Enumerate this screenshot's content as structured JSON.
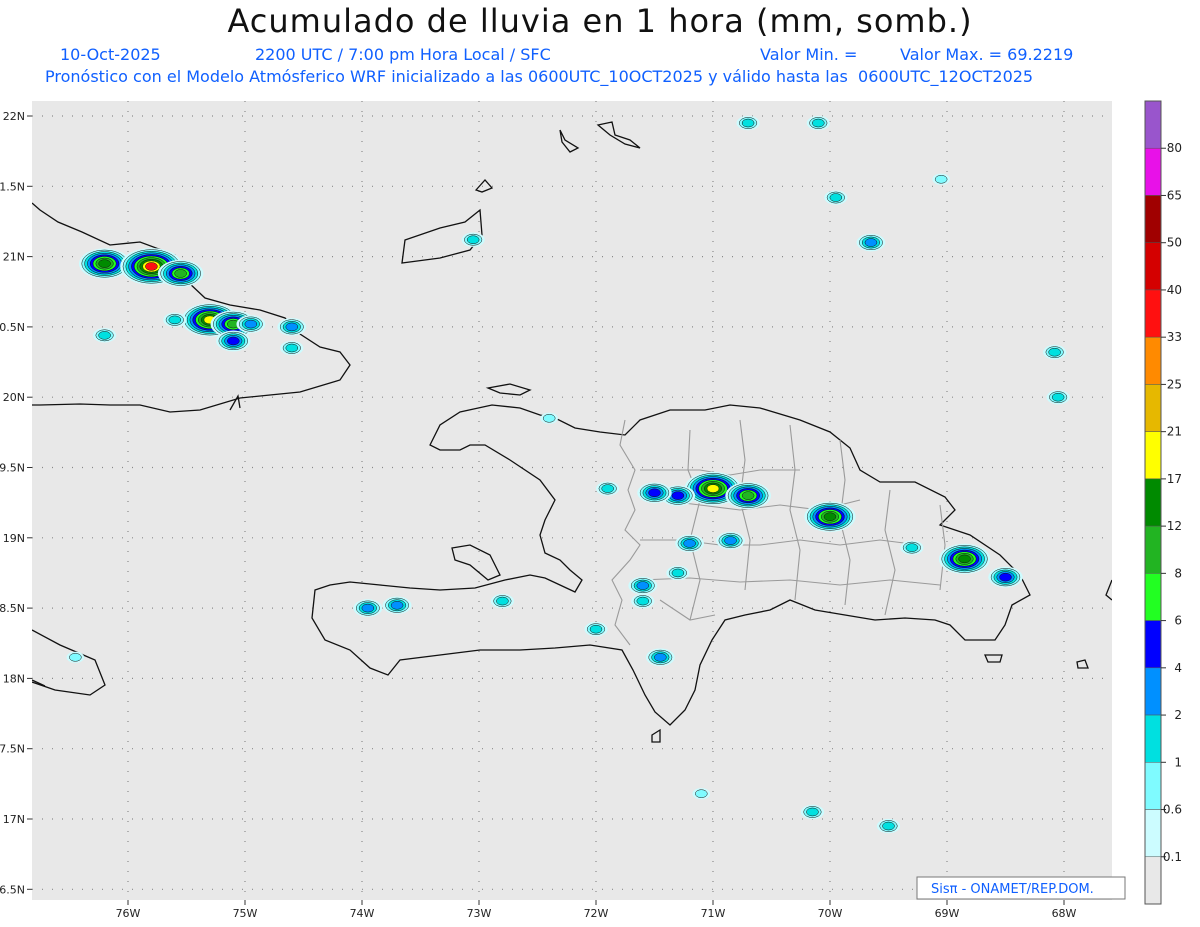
{
  "header": {
    "title": "Acumulado de lluvia en 1 hora (mm, somb.)",
    "date": "10-Oct-2025",
    "time": "2200 UTC / 7:00 pm Hora Local / SFC",
    "val_min": "Valor Min. =",
    "val_max": "Valor Max. = 69.2219",
    "forecast": "Pronóstico con el Modelo Atmósferico WRF inicializado a las 0600UTC_10OCT2025 y válido hasta las  0600UTC_12OCT2025"
  },
  "credit": "Sisπ - ONAMET/REP.DOM.",
  "axes": {
    "lon_labels": [
      "76W",
      "75W",
      "74W",
      "73W",
      "72W",
      "71W",
      "70W",
      "69W",
      "68W"
    ],
    "lat_labels": [
      "22N",
      "1.5N",
      "21N",
      "0.5N",
      "20N",
      "9.5N",
      "19N",
      "8.5N",
      "18N",
      "7.5N",
      "17N",
      "6.5N"
    ]
  },
  "colorbar": {
    "labels": [
      "80",
      "65",
      "50",
      "40",
      "33",
      "25",
      "21",
      "17",
      "12",
      "8",
      "6",
      "4",
      "2",
      "1",
      "0.6",
      "0.1"
    ],
    "colors": [
      "#9955cc",
      "#e811e8",
      "#a00000",
      "#d40000",
      "#ff1010",
      "#ff8a00",
      "#e6b800",
      "#ffff00",
      "#008a00",
      "#22b422",
      "#22ff22",
      "#0000ff",
      "#0090ff",
      "#00e0e0",
      "#7ffbff",
      "#ccfcff",
      "#e8e8e8"
    ]
  },
  "rain_cells": [
    {
      "lon": -76.2,
      "lat": 20.95,
      "level": 7
    },
    {
      "lon": -75.8,
      "lat": 20.93,
      "level": 9
    },
    {
      "lon": -75.55,
      "lat": 20.88,
      "level": 6
    },
    {
      "lon": -75.3,
      "lat": 20.55,
      "level": 8
    },
    {
      "lon": -75.1,
      "lat": 20.52,
      "level": 6
    },
    {
      "lon": -75.1,
      "lat": 20.4,
      "level": 4
    },
    {
      "lon": -74.95,
      "lat": 20.52,
      "level": 3
    },
    {
      "lon": -74.6,
      "lat": 20.5,
      "level": 3
    },
    {
      "lon": -74.6,
      "lat": 20.35,
      "level": 2
    },
    {
      "lon": -75.6,
      "lat": 20.55,
      "level": 2
    },
    {
      "lon": -76.2,
      "lat": 20.44,
      "level": 2
    },
    {
      "lon": -71.0,
      "lat": 19.35,
      "level": 8
    },
    {
      "lon": -70.7,
      "lat": 19.3,
      "level": 6
    },
    {
      "lon": -71.3,
      "lat": 19.3,
      "level": 4
    },
    {
      "lon": -71.5,
      "lat": 19.32,
      "level": 4
    },
    {
      "lon": -70.0,
      "lat": 19.15,
      "level": 7
    },
    {
      "lon": -68.85,
      "lat": 18.85,
      "level": 7
    },
    {
      "lon": -68.5,
      "lat": 18.72,
      "level": 4
    },
    {
      "lon": -70.85,
      "lat": 18.98,
      "level": 3
    },
    {
      "lon": -71.2,
      "lat": 18.96,
      "level": 3
    },
    {
      "lon": -71.6,
      "lat": 18.66,
      "level": 3
    },
    {
      "lon": -71.3,
      "lat": 18.75,
      "level": 2
    },
    {
      "lon": -71.45,
      "lat": 18.15,
      "level": 3
    },
    {
      "lon": -73.95,
      "lat": 18.5,
      "level": 3
    },
    {
      "lon": -73.7,
      "lat": 18.52,
      "level": 3
    },
    {
      "lon": -72.8,
      "lat": 18.55,
      "level": 2
    },
    {
      "lon": -69.3,
      "lat": 18.93,
      "level": 2
    },
    {
      "lon": -71.9,
      "lat": 19.35,
      "level": 2
    },
    {
      "lon": -71.6,
      "lat": 18.55,
      "level": 2
    },
    {
      "lon": -70.7,
      "lat": 21.95,
      "level": 2
    },
    {
      "lon": -70.1,
      "lat": 21.95,
      "level": 2
    },
    {
      "lon": -69.65,
      "lat": 21.1,
      "level": 3
    },
    {
      "lon": -69.95,
      "lat": 21.42,
      "level": 2
    },
    {
      "lon": -68.08,
      "lat": 20.32,
      "level": 2
    },
    {
      "lon": -68.05,
      "lat": 20.0,
      "level": 2
    },
    {
      "lon": -70.15,
      "lat": 17.05,
      "level": 2
    },
    {
      "lon": -69.5,
      "lat": 16.95,
      "level": 2
    },
    {
      "lon": -72.0,
      "lat": 18.35,
      "level": 2
    },
    {
      "lon": -73.05,
      "lat": 21.12,
      "level": 2
    },
    {
      "lon": -72.4,
      "lat": 19.85,
      "level": 1
    },
    {
      "lon": -69.05,
      "lat": 21.55,
      "level": 1
    },
    {
      "lon": -76.45,
      "lat": 18.15,
      "level": 1
    },
    {
      "lon": -71.1,
      "lat": 17.18,
      "level": 1
    }
  ]
}
